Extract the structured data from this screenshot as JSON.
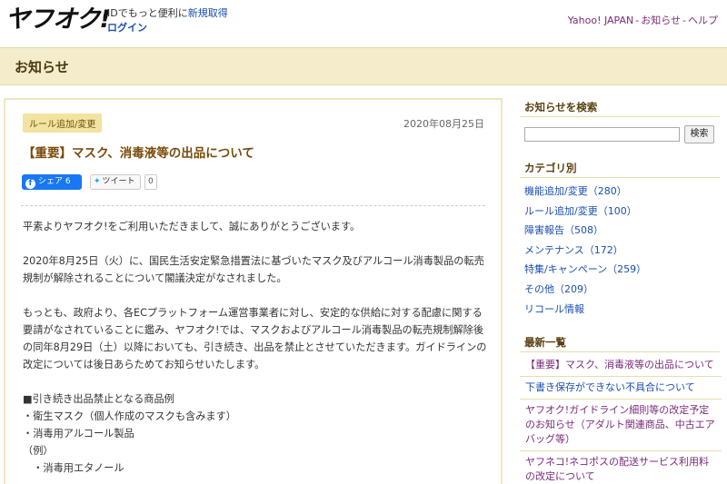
{
  "header": {
    "logo": "ヤフオク!",
    "login_msg_prefix": "IDでもっと便利に",
    "signup_link": "新規取得",
    "login_link": "ログイン",
    "links": [
      "Yahoo! JAPAN",
      "お知らせ",
      "ヘルプ"
    ]
  },
  "page_title": "お知らせ",
  "article": {
    "category": "ルール追加/変更",
    "date": "2020年08月25日",
    "title": "【重要】マスク、消毒液等の出品について",
    "share_label": "シェア 6",
    "share_icon": "facebook-icon",
    "tweet_label": "ツイート",
    "tweet_icon": "twitter-bird-icon",
    "tweet_count": "0",
    "paragraphs": [
      "平素よりヤフオク!をご利用いただきまして、誠にありがとうございます。",
      "2020年8月25日（火）に、国民生活安定緊急措置法に基づいたマスク及びアルコール消毒製品の転売規制が解除されることについて閣議決定がなされました。",
      "もっとも、政府より、各ECプラットフォーム運営事業者に対し、安定的な供給に対する配慮に関する要請がなされていることに鑑み、ヤフオク!では、マスクおよびアルコール消毒製品の転売規制解除後の同年8月29日（土）以降においても、引き続き、出品を禁止とさせていただきます。ガイドラインの改定については後日あらためてお知らせいたします。"
    ],
    "list": [
      "■引き続き出品禁止となる商品例",
      "・衛生マスク（個人作成のマスクも含みます）",
      "・消毒用アルコール製品",
      "（例）",
      "　・消毒用エタノール"
    ]
  },
  "sidebar": {
    "search_heading": "お知らせを検索",
    "search_button": "検索",
    "search_value": "",
    "category_heading": "カテゴリ別",
    "categories": [
      "機能追加/変更（280）",
      "ルール追加/変更（100）",
      "障害報告（508）",
      "メンテナンス（172）",
      "特集/キャンペーン（259）",
      "その他（209）",
      "リコール情報"
    ],
    "latest_heading": "最新一覧",
    "latest": [
      "【重要】マスク、消毒液等の出品について",
      "下書き保存ができない不具合について",
      "ヤフオク!ガイドライン細則等の改定予定のお知らせ（アダルト関連商品、中古エアバッグ等）",
      "ヤフネコ!ネコポスの配送サービス利用料の改定について"
    ]
  },
  "colors": {
    "title_bar_bg": "#f4eccb",
    "link_blue": "#1a4fb0",
    "link_purple": "#7a2b7a",
    "badge_bg": "#f2e3a0",
    "facebook_blue": "#1877f2"
  }
}
